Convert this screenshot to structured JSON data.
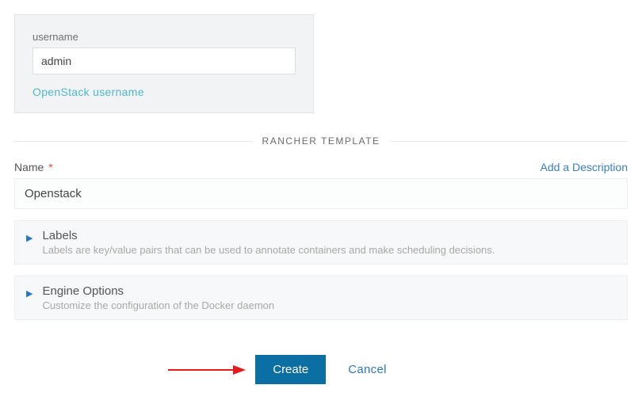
{
  "username_panel": {
    "label": "username",
    "value": "admin",
    "help_link": "OpenStack username"
  },
  "section_title": "RANCHER TEMPLATE",
  "name_field": {
    "label": "Name",
    "required_marker": "*",
    "value": "Openstack"
  },
  "add_description_label": "Add a Description",
  "accordions": [
    {
      "title": "Labels",
      "description": "Labels are key/value pairs that can be used to annotate containers and make scheduling decisions."
    },
    {
      "title": "Engine Options",
      "description": "Customize the configuration of the Docker daemon"
    }
  ],
  "buttons": {
    "create": "Create",
    "cancel": "Cancel"
  }
}
